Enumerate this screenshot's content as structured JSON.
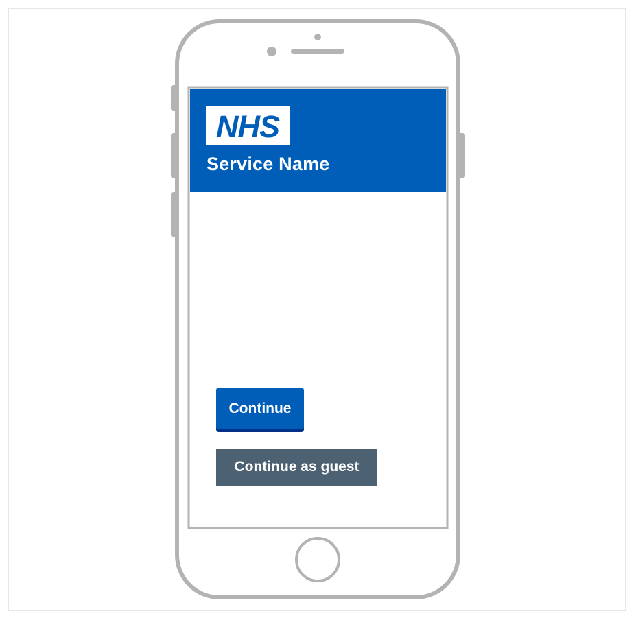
{
  "header": {
    "logo_text": "NHS",
    "service_name": "Service Name"
  },
  "actions": {
    "continue_label": "Continue",
    "guest_label": "Continue as guest"
  },
  "colors": {
    "nhs_blue": "#005eb8",
    "nhs_dark_blue": "#003087",
    "secondary_grey": "#4c6272",
    "device_grey": "#b3b3b3"
  },
  "icons": [
    "phone-frame",
    "front-camera-icon",
    "earpiece-speaker-icon",
    "sensor-dot-icon",
    "home-button-icon",
    "side-button-icon"
  ]
}
